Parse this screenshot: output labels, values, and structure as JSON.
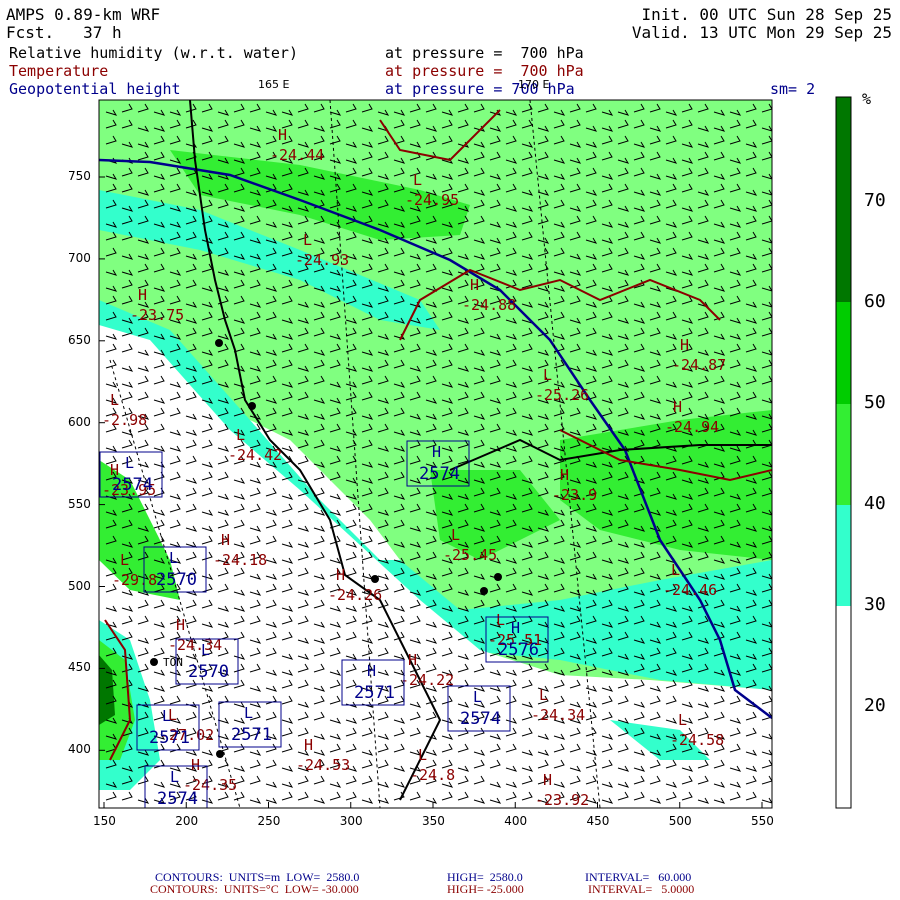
{
  "header": {
    "model": "AMPS 0.89-km WRF",
    "forecast": "Fcst.   37 h",
    "init": "Init. 00 UTC Sun 28 Sep 25",
    "valid": "Valid. 13 UTC Mon 29 Sep 25",
    "fields": [
      {
        "name": "Relative humidity (w.r.t. water)",
        "level": "at pressure =  700 hPa",
        "color": "#000000"
      },
      {
        "name": "Temperature",
        "level": "at pressure =  700 hPa",
        "color": "#8b0000"
      },
      {
        "name": "Geopotential height",
        "level": "at pressure = 700 hPa",
        "color": "#00008b"
      }
    ],
    "smoothing": "sm= 2",
    "lon_labels": [
      "165 E",
      "170 E"
    ]
  },
  "colorbar": {
    "unit": "%",
    "ticks": [
      "20",
      "30",
      "40",
      "50",
      "60",
      "70"
    ],
    "colors": [
      "#ffffff",
      "#33ffcc",
      "#80ff80",
      "#33ee33",
      "#00cc00",
      "#007700"
    ]
  },
  "axes": {
    "x_ticks": [
      "150",
      "200",
      "250",
      "300",
      "350",
      "400",
      "450",
      "500",
      "550"
    ],
    "y_ticks": [
      "750",
      "700",
      "650",
      "600",
      "550",
      "500",
      "450",
      "400"
    ]
  },
  "temperature_labels": [
    {
      "hl": "H",
      "value": "-24.44"
    },
    {
      "hl": "L",
      "value": "-24.95"
    },
    {
      "hl": "L",
      "value": "-24.93"
    },
    {
      "hl": "H",
      "value": "-23.75"
    },
    {
      "hl": "H",
      "value": "-24.88"
    },
    {
      "hl": "H",
      "value": "-24.87"
    },
    {
      "hl": "L",
      "value": "-25.26"
    },
    {
      "hl": "H",
      "value": "-24.94"
    },
    {
      "hl": "L",
      "value": "-24.42"
    },
    {
      "hl": "H",
      "value": "-23.9"
    },
    {
      "hl": "L",
      "value": "-25.45"
    },
    {
      "hl": "H",
      "value": "-23.95"
    },
    {
      "hl": "H",
      "value": "-24.18"
    },
    {
      "hl": "L",
      "value": "-29.8"
    },
    {
      "hl": "H",
      "value": "-24.26"
    },
    {
      "hl": "H",
      "value": "-24.34"
    },
    {
      "hl": "L",
      "value": "-24.46"
    },
    {
      "hl": "L",
      "value": "-25.51"
    },
    {
      "hl": "H",
      "value": "-24.22"
    },
    {
      "hl": "L",
      "value": "-27.02"
    },
    {
      "hl": "L",
      "value": "-24.34"
    },
    {
      "hl": "L",
      "value": "-24.58"
    },
    {
      "hl": "H",
      "value": "-24.53"
    },
    {
      "hl": "L",
      "value": "-24.8"
    },
    {
      "hl": "H",
      "value": "-24.35"
    },
    {
      "hl": "H",
      "value": "-23.92"
    },
    {
      "hl": "L",
      "value": "-2.98"
    }
  ],
  "height_labels": [
    {
      "hl": "H",
      "value": "2574"
    },
    {
      "hl": "L",
      "value": "2570"
    },
    {
      "hl": "L",
      "value": "2570"
    },
    {
      "hl": "H",
      "value": "2571"
    },
    {
      "hl": "L",
      "value": "2571"
    },
    {
      "hl": "L",
      "value": "2571"
    },
    {
      "hl": "L",
      "value": "2574"
    },
    {
      "hl": "H",
      "value": "2576"
    },
    {
      "hl": "L",
      "value": "2574"
    },
    {
      "hl": "L",
      "value": "2574"
    }
  ],
  "station": "TON",
  "footer": {
    "height": {
      "label": "CONTOURS:  UNITS=m  LOW=  2580.0",
      "high": "HIGH=  2580.0",
      "interval": "INTERVAL=   60.000",
      "color": "#00008b"
    },
    "temp": {
      "label": "CONTOURS:  UNITS=°C  LOW= -30.000",
      "high": "HIGH= -25.000",
      "interval": "INTERVAL=   5.0000",
      "color": "#8b0000"
    }
  }
}
